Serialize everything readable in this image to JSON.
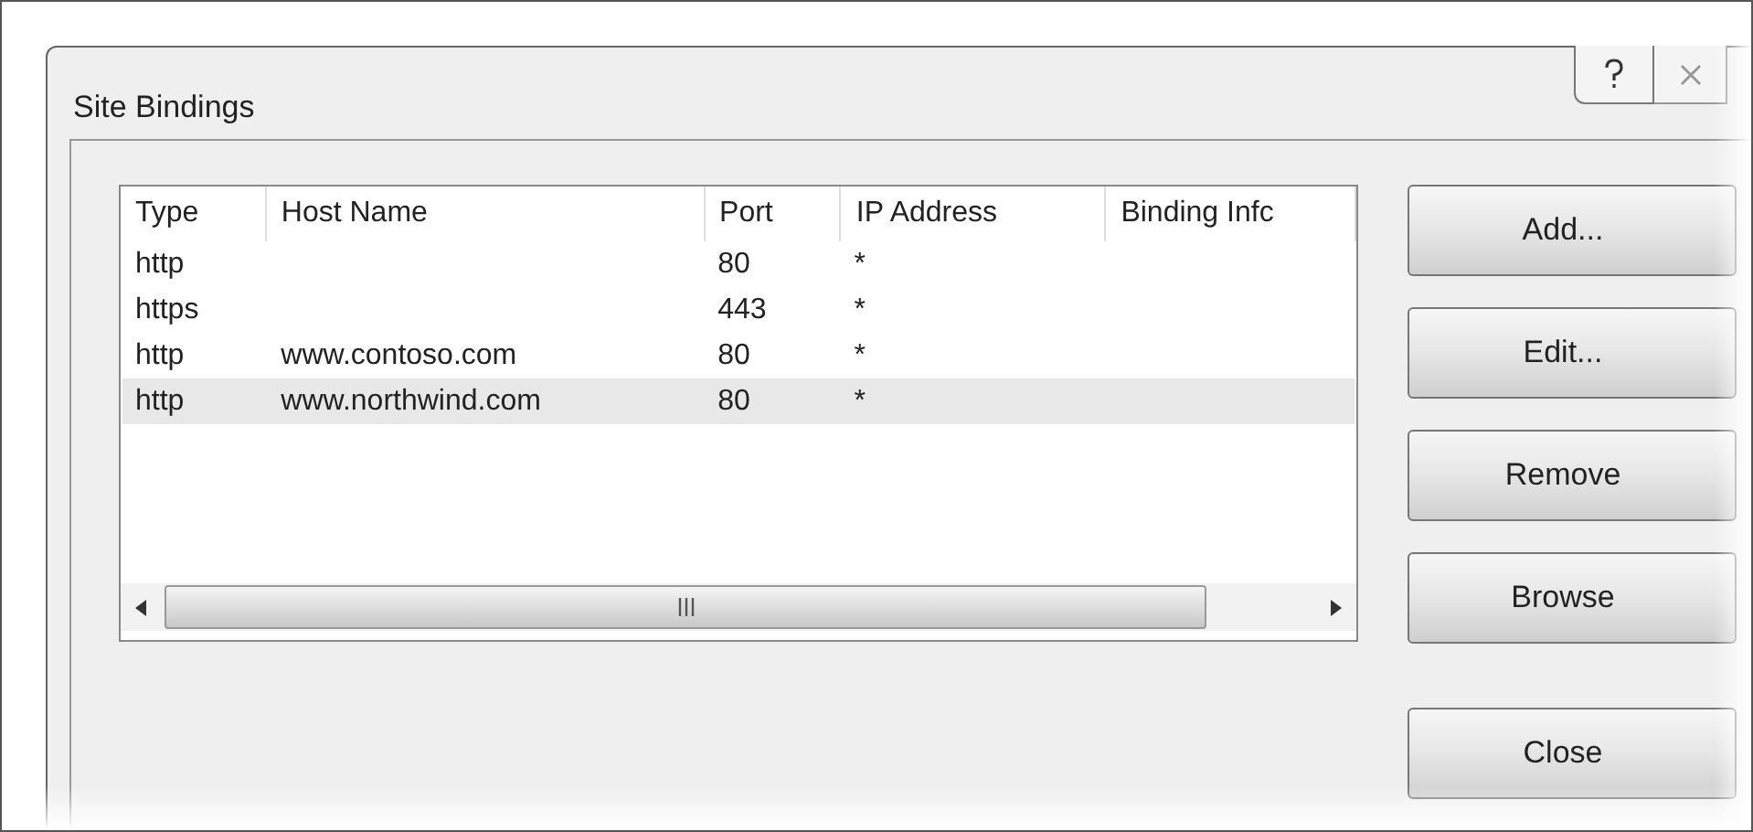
{
  "window": {
    "title": "Site Bindings"
  },
  "table": {
    "columns": [
      "Type",
      "Host Name",
      "Port",
      "IP Address",
      "Binding Infc"
    ],
    "rows": [
      {
        "cells": [
          "http",
          "",
          "80",
          "*",
          ""
        ],
        "selected": false
      },
      {
        "cells": [
          "https",
          "",
          "443",
          "*",
          ""
        ],
        "selected": false
      },
      {
        "cells": [
          "http",
          "www.contoso.com",
          "80",
          "*",
          ""
        ],
        "selected": false
      },
      {
        "cells": [
          "http",
          "www.northwind.com",
          "80",
          "*",
          ""
        ],
        "selected": true
      }
    ]
  },
  "buttons": [
    "Add...",
    "Edit...",
    "Remove",
    "Browse",
    "Close"
  ]
}
